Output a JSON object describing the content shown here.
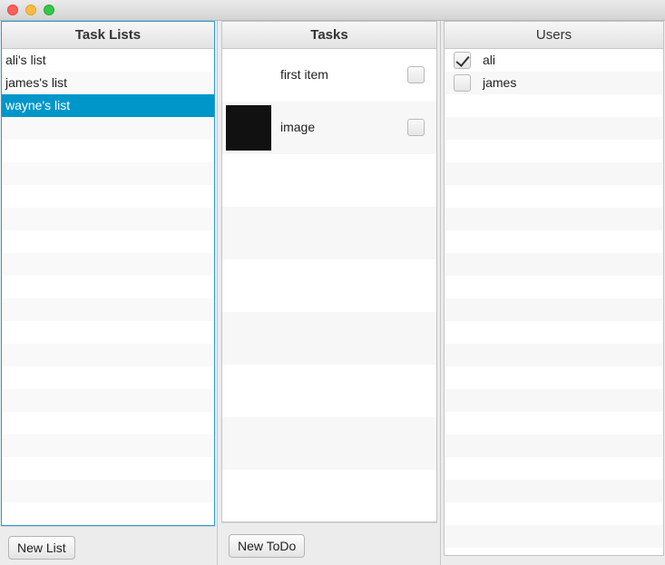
{
  "lists_pane": {
    "title": "Task Lists",
    "items": [
      "ali's list",
      "james's list",
      "wayne's list"
    ],
    "selected": "wayne's list",
    "new_button_label": "New List"
  },
  "tasks_pane": {
    "title": "Tasks",
    "items": [
      {
        "text": "first item",
        "has_image": false,
        "done": false
      },
      {
        "text": "image",
        "has_image": true,
        "done": false
      }
    ],
    "new_button_label": "New ToDo"
  },
  "users_pane": {
    "title": "Users",
    "users": [
      {
        "name": "ali",
        "checked": true
      },
      {
        "name": "james",
        "checked": false
      }
    ]
  },
  "colors": {
    "selection": "#0096c9",
    "focus_border": "#2b9bd4"
  }
}
